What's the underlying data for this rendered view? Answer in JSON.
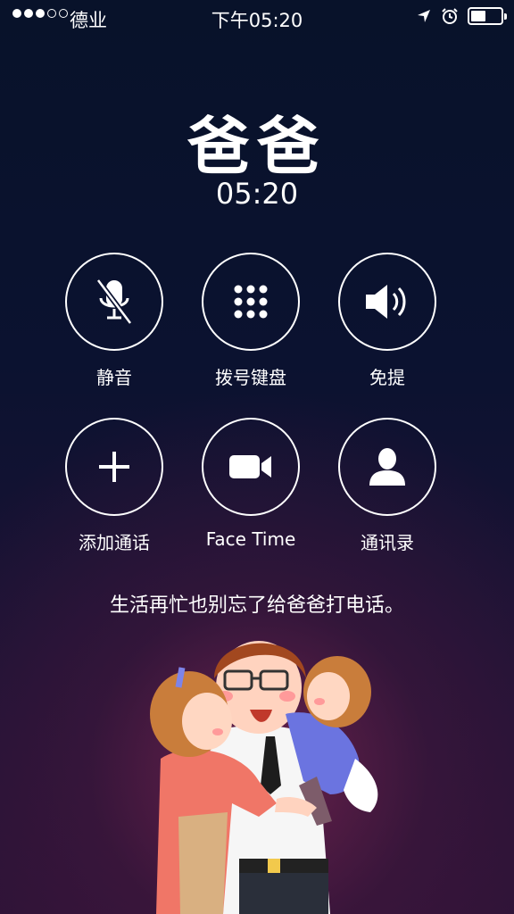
{
  "status_bar": {
    "carrier": "德业",
    "time": "下午05:20",
    "signal_bars_filled": 3,
    "signal_bars_total": 5,
    "battery_level": 0.5
  },
  "call": {
    "caller_name": "爸爸",
    "duration": "05:20"
  },
  "controls": [
    {
      "label": "静音",
      "icon": "mute-icon"
    },
    {
      "label": "拨号键盘",
      "icon": "keypad-icon"
    },
    {
      "label": "免提",
      "icon": "speaker-icon"
    },
    {
      "label": "添加通话",
      "icon": "add-call-icon"
    },
    {
      "label": "Face Time",
      "icon": "facetime-icon"
    },
    {
      "label": "通讯录",
      "icon": "contacts-icon"
    }
  ],
  "message": "生活再忙也别忘了给爸爸打电话。",
  "colors": {
    "background_top": "#08122a",
    "background_glow": "#782450",
    "foreground": "#ffffff"
  }
}
